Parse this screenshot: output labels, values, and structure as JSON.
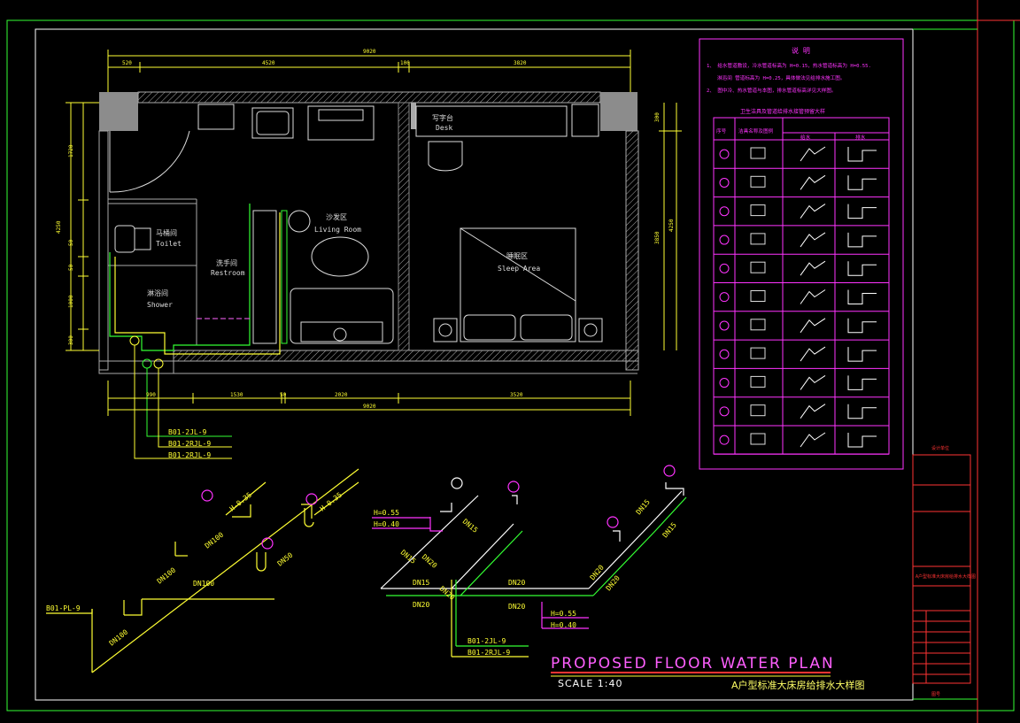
{
  "drawing": {
    "title": "PROPOSED FLOOR WATER PLAN",
    "scale": "SCALE 1:40",
    "subtitle": "A户型标准大床房给排水大样图"
  },
  "plan": {
    "top_dimension_total": "9020",
    "top_dimensions": [
      "520",
      "4520",
      "100",
      "3820"
    ],
    "bottom_dimension_total": "9020",
    "bottom_dimensions": [
      "990",
      "1530",
      "50",
      "2020",
      "3520"
    ],
    "left_dimension_total": "4250",
    "left_dimensions": [
      "1720",
      "50",
      "50",
      "1000",
      "300"
    ],
    "right_dimension_total": "4250",
    "right_dimensions": [
      "300",
      "3850"
    ],
    "rooms": [
      {
        "cn": "写字台",
        "en": "Desk"
      },
      {
        "cn": "沙发区",
        "en": "Living Room"
      },
      {
        "cn": "马桶间",
        "en": "Toilet"
      },
      {
        "cn": "洗手间",
        "en": "Restroom"
      },
      {
        "cn": "淋浴间",
        "en": "Shower"
      },
      {
        "cn": "睡眠区",
        "en": "Sleep Area"
      }
    ],
    "riser_labels": [
      "B01-2JL-9",
      "B01-2RJL-9",
      "B01-2RJL-9"
    ]
  },
  "isometric": {
    "left": {
      "pipe_label": "B01-PL-9",
      "dn_labels": [
        "DN100",
        "DN100",
        "DN100",
        "DN100",
        "DN50"
      ],
      "height_labels": [
        "H-0.35",
        "H-0.35"
      ]
    },
    "right": {
      "height_labels": [
        "H=0.55",
        "H=0.40",
        "H=0.55",
        "H=0.40"
      ],
      "dn_labels": [
        "DN15",
        "DN15",
        "DN20",
        "DN15",
        "DN20",
        "DN20",
        "DN20",
        "DN15",
        "DN15",
        "DN20",
        "DN20",
        "DN20"
      ],
      "riser_labels": [
        "B01-2JL-9",
        "B01-2RJL-9"
      ]
    }
  },
  "legend": {
    "title": "说 明",
    "notes": [
      "1、 给水管道敷设，冷水管道标高为 H=0.15，热水管道标高为 H=0.55.",
      "淋浴间 管道标高为 H=0.25，具体做法见给排水施工图。",
      "2、 图中冷、热水管道与本图，排水管道标高详见大样图。"
    ],
    "table_title": "卫生洁具及管道给排水接管预留大样",
    "columns": [
      "序号",
      "洁具名称及图例",
      "给水",
      "排水"
    ],
    "row_count": 11
  },
  "title_block": {
    "items": [
      "设计单位",
      "A户型标准大床房给排水大样图",
      "图号"
    ]
  },
  "colors": {
    "background": "#000000",
    "wall": "#8c8c8c",
    "dimension": "#ffff33",
    "frame_green": "#33ff33",
    "frame_red": "#ff3333",
    "magenta": "#ff33ff",
    "white": "#ffffff",
    "cyan": "#33ffff"
  }
}
